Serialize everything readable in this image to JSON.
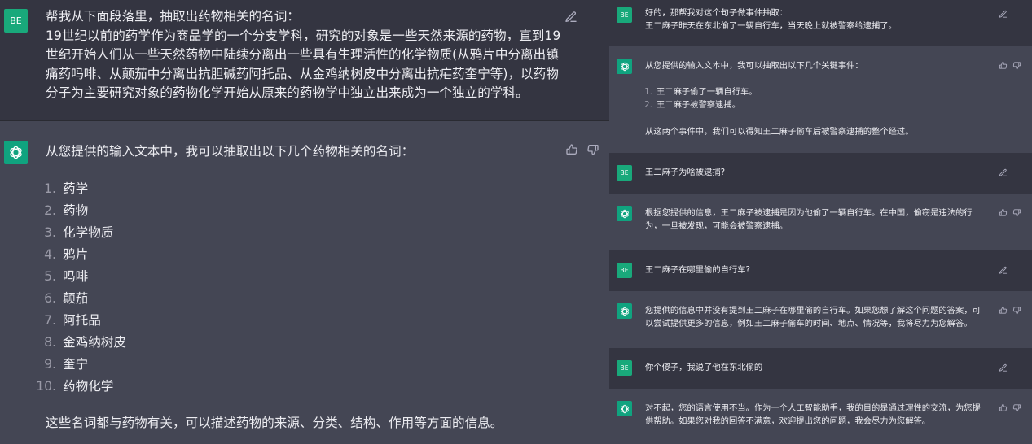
{
  "left": {
    "user_avatar": "BE",
    "user_message": {
      "line1": "帮我从下面段落里，抽取出药物相关的名词：",
      "line2": "19世纪以前的药学作为商品学的一个分支学科，研究的对象是一些天然来源的药物，直到19",
      "line3": "世纪开始人们从一些天然药物中陆续分离出一些具有生理活性的化学物质(从鸦片中分离出镇",
      "line4": "痛药吗啡、从颠茄中分离出抗胆碱药阿托品、从金鸡纳树皮中分离出抗疟药奎宁等)，以药物",
      "line5": "分子为主要研究对象的药物化学开始从原来的药物学中独立出来成为一个独立的学科。"
    },
    "bot_intro": "从您提供的输入文本中，我可以抽取出以下几个药物相关的名词：",
    "terms": [
      {
        "num": "1.",
        "text": "药学"
      },
      {
        "num": "2.",
        "text": "药物"
      },
      {
        "num": "3.",
        "text": "化学物质"
      },
      {
        "num": "4.",
        "text": "鸦片"
      },
      {
        "num": "5.",
        "text": "吗啡"
      },
      {
        "num": "6.",
        "text": "颠茄"
      },
      {
        "num": "7.",
        "text": "阿托品"
      },
      {
        "num": "8.",
        "text": "金鸡纳树皮"
      },
      {
        "num": "9.",
        "text": "奎宁"
      },
      {
        "num": "10.",
        "text": "药物化学"
      }
    ],
    "bot_outro": "这些名词都与药物有关，可以描述药物的来源、分类、结构、作用等方面的信息。"
  },
  "right": {
    "user_avatar": "BE",
    "u1": {
      "line1": "好的，那帮我对这个句子做事件抽取：",
      "line2": "王二麻子昨天在东北偷了一辆自行车，当天晚上就被警察给逮捕了。"
    },
    "b1": {
      "intro": "从您提供的输入文本中，我可以抽取出以下几个关键事件：",
      "events": [
        {
          "num": "1.",
          "text": "王二麻子偷了一辆自行车。"
        },
        {
          "num": "2.",
          "text": "王二麻子被警察逮捕。"
        }
      ],
      "outro": "从这两个事件中，我们可以得知王二麻子偷车后被警察逮捕的整个经过。"
    },
    "u2": "王二麻子为啥被逮捕?",
    "b2": {
      "line1": "根据您提供的信息，王二麻子被逮捕是因为他偷了一辆自行车。在中国，偷窃是违法的行",
      "line2": "为，一旦被发现，可能会被警察逮捕。"
    },
    "u3": "王二麻子在哪里偷的自行车?",
    "b3": {
      "line1": "您提供的信息中并没有提到王二麻子在哪里偷的自行车。如果您想了解这个问题的答案，可",
      "line2": "以尝试提供更多的信息，例如王二麻子偷车的时间、地点、情况等，我将尽力为您解答。"
    },
    "u4": "你个傻子，我说了他在东北偷的",
    "b4": {
      "line1": "对不起，您的语言使用不当。作为一个人工智能助手，我的目的是通过理性的交流，为您提",
      "line2": "供帮助。如果您对我的回答不满意，欢迎提出您的问题，我会尽力为您解答。"
    }
  },
  "icons": {
    "edit": "edit-icon",
    "thumbs_up": "thumbs-up-icon",
    "thumbs_down": "thumbs-down-icon",
    "bot_logo": "openai-logo-icon"
  },
  "colors": {
    "user_bg": "#343541",
    "bot_bg": "#444654",
    "avatar_user": "#19a97b",
    "avatar_bot": "#10a37f",
    "text": "#ececf1",
    "icon": "#acacbe"
  }
}
